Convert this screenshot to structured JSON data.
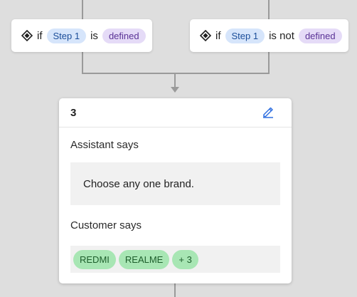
{
  "conditions": [
    {
      "prefix": "if",
      "step": "Step 1",
      "operator": "is",
      "value": "defined"
    },
    {
      "prefix": "if",
      "step": "Step 1",
      "operator": "is not",
      "value": "defined"
    }
  ],
  "step_card": {
    "number": "3",
    "edit_icon": "pencil-edit-icon",
    "assistant_label": "Assistant says",
    "assistant_message": "Choose any one brand.",
    "customer_label": "Customer says",
    "customer_options": [
      "REDMI",
      "REALME",
      "+ 3"
    ]
  },
  "colors": {
    "background": "#dedede",
    "connector": "#9a9a9a",
    "step_pill_bg": "#d6e5fb",
    "step_pill_text": "#1b4d99",
    "value_pill_bg": "#e5dbf7",
    "value_pill_text": "#5a3296",
    "chip_bg": "#a8e6b4",
    "chip_text": "#1e5e2c",
    "edit_icon": "#2f6fe0"
  }
}
